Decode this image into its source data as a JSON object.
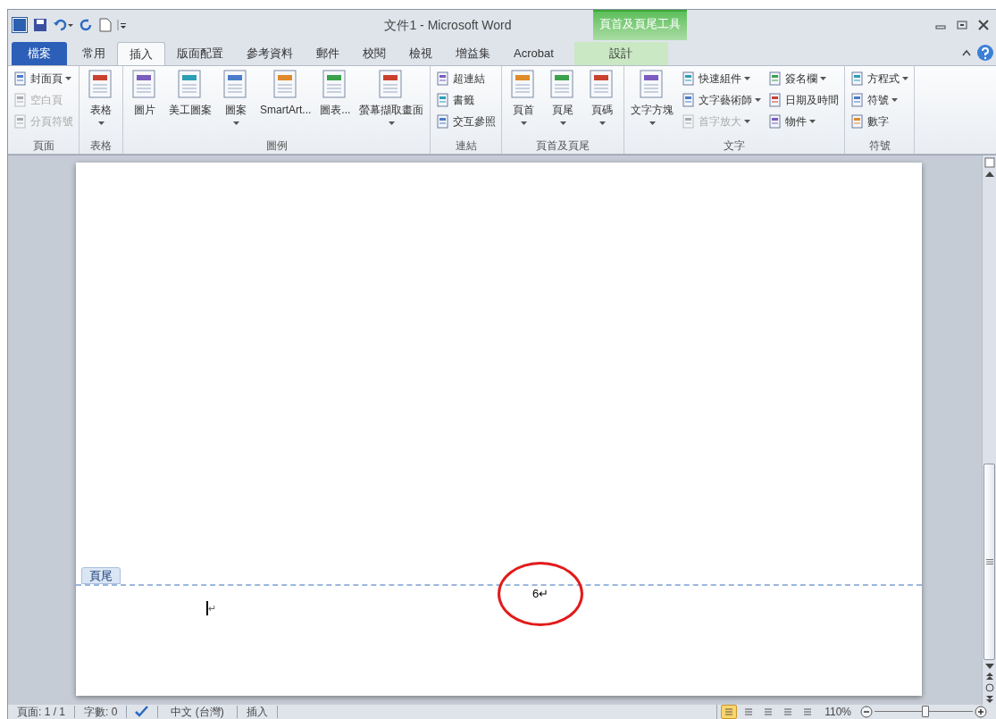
{
  "window": {
    "title": "文件1 - Microsoft Word"
  },
  "contextual_group": {
    "label": "頁首及頁尾工具"
  },
  "tabs": [
    {
      "label": "檔案",
      "kind": "file",
      "selected": false
    },
    {
      "label": "常用",
      "kind": "normal",
      "selected": false
    },
    {
      "label": "插入",
      "kind": "normal",
      "selected": true
    },
    {
      "label": "版面配置",
      "kind": "normal",
      "selected": false
    },
    {
      "label": "參考資料",
      "kind": "normal",
      "selected": false
    },
    {
      "label": "郵件",
      "kind": "normal",
      "selected": false
    },
    {
      "label": "校閱",
      "kind": "normal",
      "selected": false
    },
    {
      "label": "檢視",
      "kind": "normal",
      "selected": false
    },
    {
      "label": "增益集",
      "kind": "normal",
      "selected": false
    },
    {
      "label": "Acrobat",
      "kind": "normal",
      "selected": false
    },
    {
      "label": "設計",
      "kind": "contextual",
      "selected": false
    }
  ],
  "ribbon_groups": [
    {
      "label": "頁面",
      "columns": [
        [
          {
            "label": "封面頁",
            "kind": "small",
            "dropdown": true,
            "disabled": false
          },
          {
            "label": "空白頁",
            "kind": "small",
            "dropdown": false,
            "disabled": true
          },
          {
            "label": "分頁符號",
            "kind": "small",
            "dropdown": false,
            "disabled": true
          }
        ]
      ]
    },
    {
      "label": "表格",
      "columns": [
        [
          {
            "label": "表格",
            "kind": "large",
            "dropdown": true,
            "disabled": false
          }
        ]
      ]
    },
    {
      "label": "圖例",
      "columns": [
        [
          {
            "label": "圖片",
            "kind": "large",
            "dropdown": false,
            "disabled": false
          }
        ],
        [
          {
            "label": "美工圖案",
            "kind": "large",
            "dropdown": false,
            "disabled": false
          }
        ],
        [
          {
            "label": "圖案",
            "kind": "large",
            "dropdown": true,
            "disabled": false
          }
        ],
        [
          {
            "label": "SmartArt...",
            "kind": "large",
            "dropdown": false,
            "disabled": false
          }
        ],
        [
          {
            "label": "圖表...",
            "kind": "large",
            "dropdown": false,
            "disabled": false
          }
        ],
        [
          {
            "label": "螢幕擷取畫面",
            "kind": "large",
            "dropdown": true,
            "disabled": false
          }
        ]
      ]
    },
    {
      "label": "連結",
      "columns": [
        [
          {
            "label": "超連結",
            "kind": "small",
            "dropdown": false,
            "disabled": false
          },
          {
            "label": "書籤",
            "kind": "small",
            "dropdown": false,
            "disabled": false
          },
          {
            "label": "交互參照",
            "kind": "small",
            "dropdown": false,
            "disabled": false
          }
        ]
      ]
    },
    {
      "label": "頁首及頁尾",
      "columns": [
        [
          {
            "label": "頁首",
            "kind": "large",
            "dropdown": true,
            "disabled": false
          }
        ],
        [
          {
            "label": "頁尾",
            "kind": "large",
            "dropdown": true,
            "disabled": false
          }
        ],
        [
          {
            "label": "頁碼",
            "kind": "large",
            "dropdown": true,
            "disabled": false
          }
        ]
      ]
    },
    {
      "label": "文字",
      "columns": [
        [
          {
            "label": "文字方塊",
            "kind": "large",
            "dropdown": true,
            "disabled": false
          }
        ],
        [
          {
            "label": "快速組件",
            "kind": "small",
            "dropdown": true,
            "disabled": false
          },
          {
            "label": "文字藝術師",
            "kind": "small",
            "dropdown": true,
            "disabled": false
          },
          {
            "label": "首字放大",
            "kind": "small",
            "dropdown": true,
            "disabled": true
          }
        ],
        [
          {
            "label": "簽名欄",
            "kind": "small",
            "dropdown": true,
            "disabled": false
          },
          {
            "label": "日期及時間",
            "kind": "small",
            "dropdown": false,
            "disabled": false
          },
          {
            "label": "物件",
            "kind": "small",
            "dropdown": true,
            "disabled": false
          }
        ]
      ]
    },
    {
      "label": "符號",
      "columns": [
        [
          {
            "label": "方程式",
            "kind": "small",
            "dropdown": true,
            "disabled": false
          },
          {
            "label": "符號",
            "kind": "small",
            "dropdown": true,
            "disabled": false
          },
          {
            "label": "數字",
            "kind": "small",
            "dropdown": false,
            "disabled": false
          }
        ]
      ]
    }
  ],
  "document": {
    "footer_tag": "頁尾",
    "page_number": "6↵",
    "cursor_mark": "↵"
  },
  "status_bar": {
    "items": [
      "頁面: 1 / 1",
      "字數: 0"
    ],
    "language": "中文 (台灣)",
    "mode": "插入",
    "views": [
      {
        "selected": true
      },
      {
        "selected": false
      },
      {
        "selected": false
      },
      {
        "selected": false
      },
      {
        "selected": false
      }
    ],
    "zoom": "110%",
    "zoom_slider": {
      "level": 0.52
    }
  }
}
